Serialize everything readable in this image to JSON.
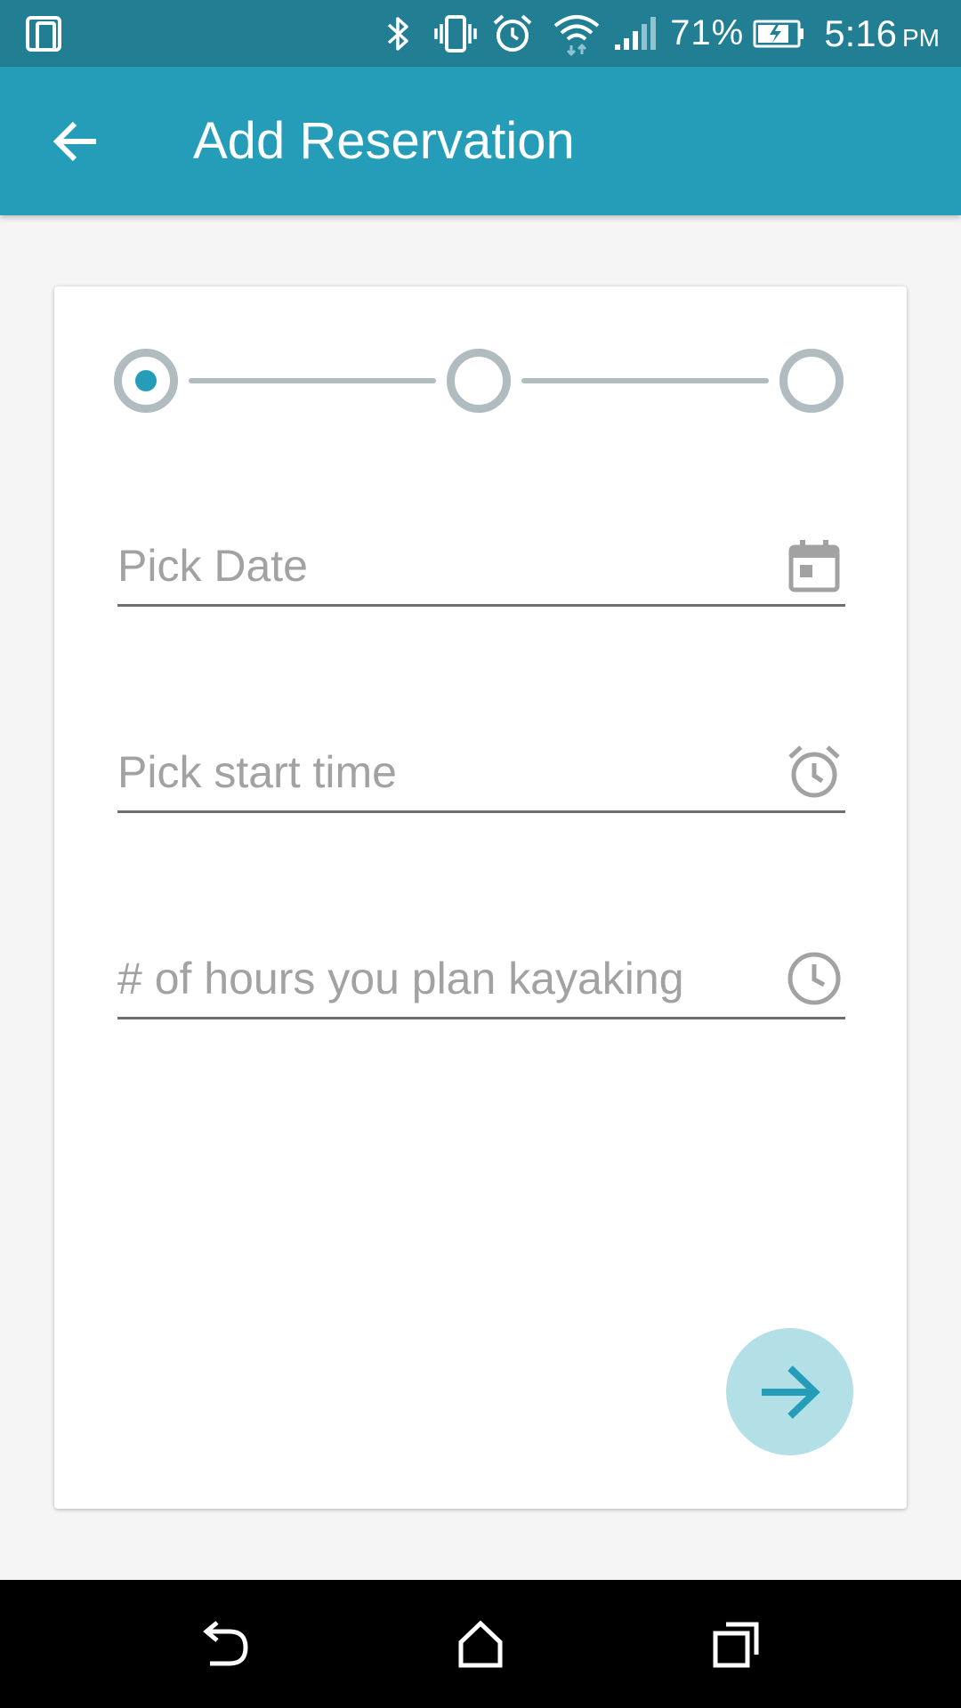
{
  "status_bar": {
    "battery_percent": "71%",
    "time": "5:16",
    "ampm": "PM",
    "icons": [
      "phone-tablet-icon",
      "bluetooth-icon",
      "vibrate-icon",
      "alarm-icon",
      "wifi-icon",
      "signal-icon",
      "battery-charging-icon"
    ]
  },
  "app_bar": {
    "title": "Add Reservation",
    "back_icon": "arrow-back-icon"
  },
  "stepper": {
    "steps": 3,
    "current_step": 1
  },
  "form": {
    "date_placeholder": "Pick Date",
    "date_icon": "calendar-icon",
    "start_time_placeholder": "Pick start time",
    "start_time_icon": "alarm-icon",
    "hours_placeholder": "# of hours you plan kayaking",
    "hours_icon": "clock-icon"
  },
  "fab": {
    "icon": "arrow-forward-icon"
  },
  "nav_bar": {
    "icons": [
      "back-icon",
      "home-icon",
      "recents-icon"
    ]
  },
  "colors": {
    "status_bar": "#217e93",
    "app_bar": "#259db8",
    "accent": "#259db8",
    "fab_bg": "#b3dfe7",
    "step_inactive": "#b0bcc0",
    "placeholder": "#a2a2a2"
  }
}
